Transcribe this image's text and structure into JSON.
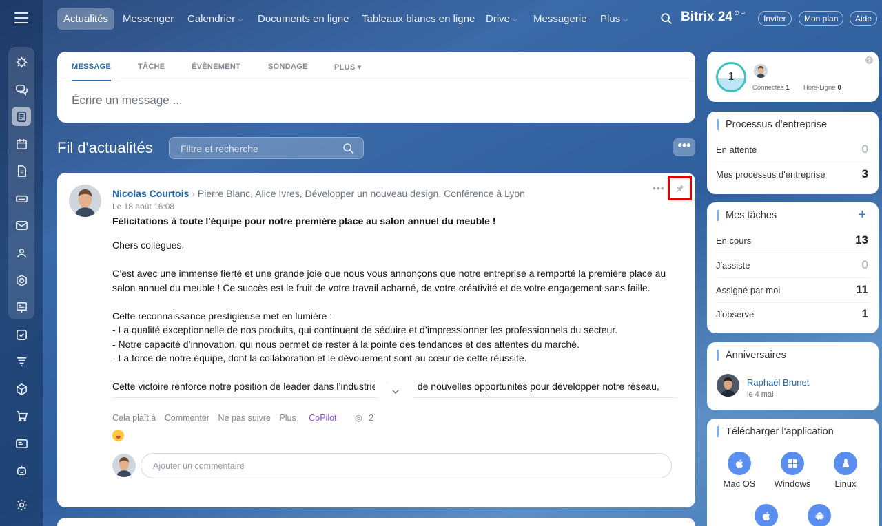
{
  "nav": {
    "items": [
      {
        "label": "Actualités",
        "caret": false,
        "active": true
      },
      {
        "label": "Messenger",
        "caret": false
      },
      {
        "label": "Calendrier",
        "caret": true
      },
      {
        "label": "Documents en ligne",
        "caret": false
      },
      {
        "label": "Tableaux blancs en ligne",
        "caret": false
      },
      {
        "label": "Drive",
        "caret": true
      },
      {
        "label": "Messagerie",
        "caret": false
      },
      {
        "label": "Plus",
        "caret": true
      }
    ],
    "brand": "Bitrix 24",
    "brand_suffix": "⊙ ≈",
    "buttons": {
      "invite": "Inviter",
      "plan": "Mon plan",
      "help": "Aide"
    }
  },
  "composer": {
    "tabs": [
      "MESSAGE",
      "TÂCHE",
      "ÉVÈNEMENT",
      "SONDAGE",
      "PLUS ▾"
    ],
    "placeholder": "Écrire un message ..."
  },
  "feed": {
    "title": "Fil d'actualités",
    "filter_placeholder": "Filtre et recherche",
    "more": "•••"
  },
  "post": {
    "author": "Nicolas Courtois",
    "destinations": "Pierre Blanc, Alice Ivres, Développer un nouveau design, Conférence à Lyon",
    "date": "Le 18 août 16:08",
    "title": "Félicitations à toute l'équipe pour notre première place au salon annuel du meuble !",
    "body": {
      "greeting": "Chers collègues,",
      "p1": "C’est avec une immense fierté et une grande joie que nous vous annonçons que notre entreprise a remporté la première place au salon annuel du meuble ! Ce succès est le fruit de votre travail acharné, de votre créativité et de votre engagement sans faille.",
      "intro": "Cette reconnaissance prestigieuse met en lumière :",
      "b1": "- La qualité exceptionnelle de nos produits, qui continuent de séduire et d’impressionner les professionnels du secteur.",
      "b2": "- Notre capacité d’innovation, qui nous permet de rester à la pointe des tendances et des attentes du marché.",
      "b3": "- La force de notre équipe, dont la collaboration et le dévouement sont au cœur de cette réussite.",
      "p3": "Cette victoire renforce notre position de leader dans l’industrie et ouvre de nouvelles opportunités pour développer notre réseau,"
    },
    "actions": {
      "like": "Cela plaît à",
      "comment": "Commenter",
      "unfollow": "Ne pas suivre",
      "more": "Plus",
      "copilot": "CoPilot",
      "views": "2"
    },
    "comment_placeholder": "Ajouter un commentaire",
    "dots": "•••"
  },
  "online": {
    "count": "1",
    "connected_label": "Connectés",
    "connected": "1",
    "offline_label": "Hors-Ligne",
    "offline": "0",
    "help": "?"
  },
  "processes": {
    "title": "Processus d'entreprise",
    "rows": [
      {
        "label": "En attente",
        "count": "0"
      },
      {
        "label": "Mes processus d'entreprise",
        "count": "3"
      }
    ]
  },
  "tasks": {
    "title": "Mes tâches",
    "add": "+",
    "rows": [
      {
        "label": "En cours",
        "count": "13"
      },
      {
        "label": "J'assiste",
        "count": "0"
      },
      {
        "label": "Assigné par moi",
        "count": "11"
      },
      {
        "label": "J'observe",
        "count": "1"
      }
    ]
  },
  "birthdays": {
    "title": "Anniversaires",
    "name": "Raphaël Brunet",
    "date": "le 4 mai"
  },
  "apps": {
    "title": "Télécharger l'application",
    "items": [
      {
        "label": "Mac OS",
        "icon": "apple-icon"
      },
      {
        "label": "Windows",
        "icon": "windows-icon"
      },
      {
        "label": "Linux",
        "icon": "linux-icon"
      }
    ],
    "mobile": [
      {
        "icon": "apple-icon"
      },
      {
        "icon": "android-icon"
      }
    ]
  },
  "colors": {
    "accent": "#2067b0",
    "highlight": "#e00000",
    "copilot": "#8d52e0"
  }
}
